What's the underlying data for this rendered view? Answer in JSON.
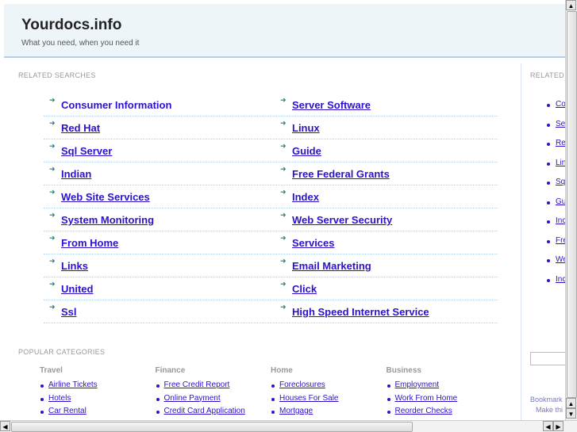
{
  "header": {
    "title": "Yourdocs.info",
    "tagline": "What you need, when you need it"
  },
  "related": {
    "label": "RELATED SEARCHES",
    "left": [
      "Consumer Information",
      "Red Hat",
      "Sql Server",
      "Indian",
      "Web Site Services",
      "System Monitoring",
      "From Home",
      "Links",
      "United",
      "Ssl"
    ],
    "right": [
      "Server Software",
      "Linux",
      "Guide",
      "Free Federal Grants",
      "Index",
      "Web Server Security",
      "Services",
      "Email Marketing",
      "Click",
      "High Speed Internet Service"
    ]
  },
  "popular": {
    "label": "POPULAR CATEGORIES",
    "categories": [
      {
        "name": "Travel",
        "links": [
          "Airline Tickets",
          "Hotels",
          "Car Rental"
        ]
      },
      {
        "name": "Finance",
        "links": [
          "Free Credit Report",
          "Online Payment",
          "Credit Card Application"
        ]
      },
      {
        "name": "Home",
        "links": [
          "Foreclosures",
          "Houses For Sale",
          "Mortgage"
        ]
      },
      {
        "name": "Business",
        "links": [
          "Employment",
          "Work From Home",
          "Reorder Checks"
        ]
      }
    ]
  },
  "sidebar": {
    "label": "RELATED",
    "links": [
      "Co",
      "Se",
      "Re",
      "Lin",
      "Sq",
      "Gu",
      "Inc",
      "Fre",
      "We",
      "Inc"
    ],
    "bookmark": "Bookmark",
    "make": "Make thi"
  }
}
